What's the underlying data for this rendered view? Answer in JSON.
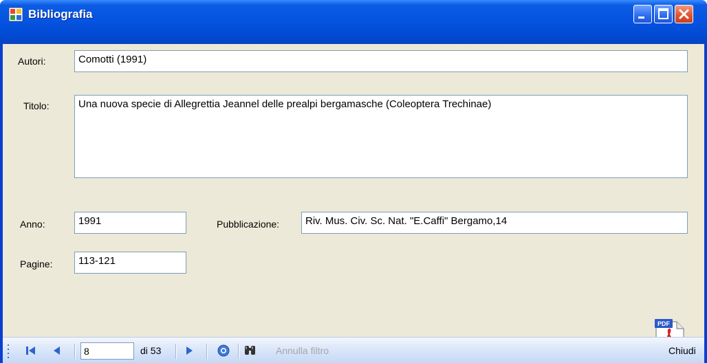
{
  "window": {
    "title": "Bibliografia"
  },
  "form": {
    "autori_label": "Autori:",
    "autori_value": "Comotti (1991)",
    "titolo_label": "Titolo:",
    "titolo_value": "Una nuova specie di Allegrettia Jeannel delle prealpi bergamasche (Coleoptera Trechinae)",
    "anno_label": "Anno:",
    "anno_value": "1991",
    "pubblicazione_label": "Pubblicazione:",
    "pubblicazione_value": "Riv. Mus. Civ. Sc. Nat. \"E.Caffi\" Bergamo,14",
    "pagine_label": "Pagine:",
    "pagine_value": "113-121",
    "pdf_icon": "pdf-icon"
  },
  "navigator": {
    "position": "8",
    "count_label": "di 53",
    "clear_filter_label": "Annulla filtro",
    "close_label": "Chiudi"
  },
  "colors": {
    "titlebar": "#0553e0",
    "client_bg": "#ece9d8",
    "toolbar_bg": "#c4d8f6",
    "field_border": "#7f9db9"
  }
}
